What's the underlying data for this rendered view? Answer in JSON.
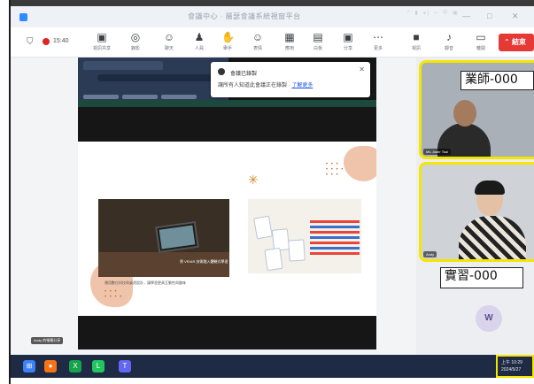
{
  "window": {
    "title": "會議中心 · 屬瑟會議系統視窗平台",
    "controls": [
      "—",
      "□",
      "✕"
    ]
  },
  "meeting": {
    "elapsed": "15:40"
  },
  "toolbar": {
    "items": [
      {
        "icon": "screen-icon",
        "glyph": "▣",
        "label": "視訊共享"
      },
      {
        "icon": "record-icon",
        "glyph": "◎",
        "label": "錄影"
      },
      {
        "icon": "chat-icon",
        "glyph": "☺",
        "label": "聊天"
      },
      {
        "icon": "participants-icon",
        "glyph": "♟",
        "label": "人員"
      },
      {
        "icon": "raise-hand-icon",
        "glyph": "✋",
        "label": "舉手"
      },
      {
        "icon": "reaction-icon",
        "glyph": "☺",
        "label": "表情"
      },
      {
        "icon": "apps-icon",
        "glyph": "▦",
        "label": "應用"
      },
      {
        "icon": "whiteboard-icon",
        "glyph": "▤",
        "label": "白板"
      },
      {
        "icon": "share-icon",
        "glyph": "▣",
        "label": "分享"
      },
      {
        "icon": "more-icon",
        "glyph": "⋯",
        "label": "更多"
      },
      {
        "icon": "camera-icon",
        "glyph": "■",
        "label": "視訊"
      },
      {
        "icon": "mic-icon",
        "glyph": "♪",
        "label": "靜音"
      },
      {
        "icon": "leave-icon",
        "glyph": "▭",
        "label": "離開"
      }
    ],
    "end_label": "結束"
  },
  "shared_screen": {
    "notification": {
      "title": "會議已錄製",
      "body": "讓所有人知道此會議正在錄製 ·",
      "link": "了解更多"
    },
    "photo_caption": "將 VR/AR 技術融入體驗式學習",
    "caption": "運用數位科技與桌遊設計，讓學習更具互動性與趣味"
  },
  "videos": [
    {
      "label": "業師-000",
      "name": "Ms. Aster Tsai"
    },
    {
      "label": "實習-000",
      "name": "Andy"
    }
  ],
  "avatar_initial": "W",
  "share_tag": "Andy 的螢幕分享",
  "taskbar": {
    "apps": [
      {
        "icon": "windows-icon",
        "glyph": "⊞",
        "color": "#3b82f6"
      },
      {
        "icon": "firefox-icon",
        "glyph": "●",
        "color": "#f97316"
      },
      {
        "icon": "excel-icon",
        "glyph": "X",
        "color": "#16a34a"
      },
      {
        "icon": "line-icon",
        "glyph": "L",
        "color": "#22c55e"
      },
      {
        "icon": "teams-icon",
        "glyph": "T",
        "color": "#6366f1"
      }
    ],
    "tray": "^ ▮ ◂) ⌁ 中 ▣",
    "time": "上午 10:29",
    "date": "2024/5/27"
  }
}
